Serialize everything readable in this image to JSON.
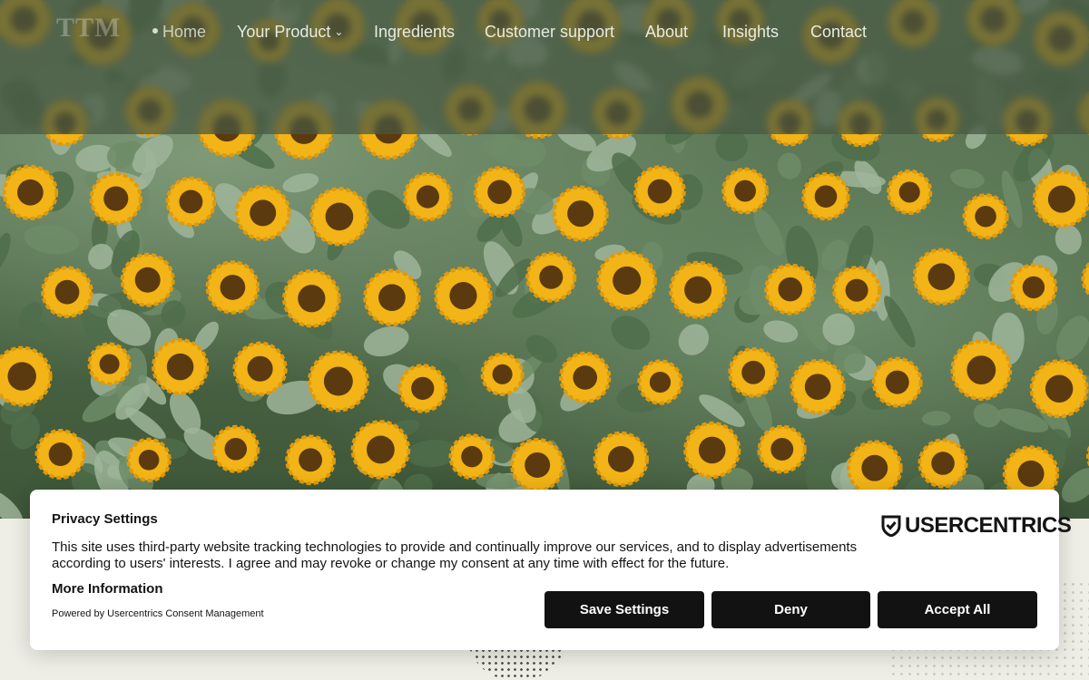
{
  "nav": {
    "logo": "TTM",
    "items": [
      {
        "label": "Home",
        "active": true
      },
      {
        "label": "Your Product",
        "has_dropdown": true
      },
      {
        "label": "Ingredients"
      },
      {
        "label": "Customer support"
      },
      {
        "label": "About"
      },
      {
        "label": "Insights"
      },
      {
        "label": "Contact"
      }
    ]
  },
  "consent": {
    "title": "Privacy Settings",
    "text": "This site uses third-party website tracking technologies to provide and continually improve our services, and to display advertisements according to users' interests. I agree and may revoke or change my consent at any time with effect for the future.",
    "more_info": "More Information",
    "powered_by": "Powered by Usercentrics Consent Management",
    "brand": "USERCENTRICS",
    "buttons": {
      "save": "Save Settings",
      "deny": "Deny",
      "accept": "Accept All"
    }
  },
  "colors": {
    "button_bg": "#121212",
    "petal": "#f2b416",
    "center": "#5b3a10",
    "leaf": "#4f6d4a"
  }
}
